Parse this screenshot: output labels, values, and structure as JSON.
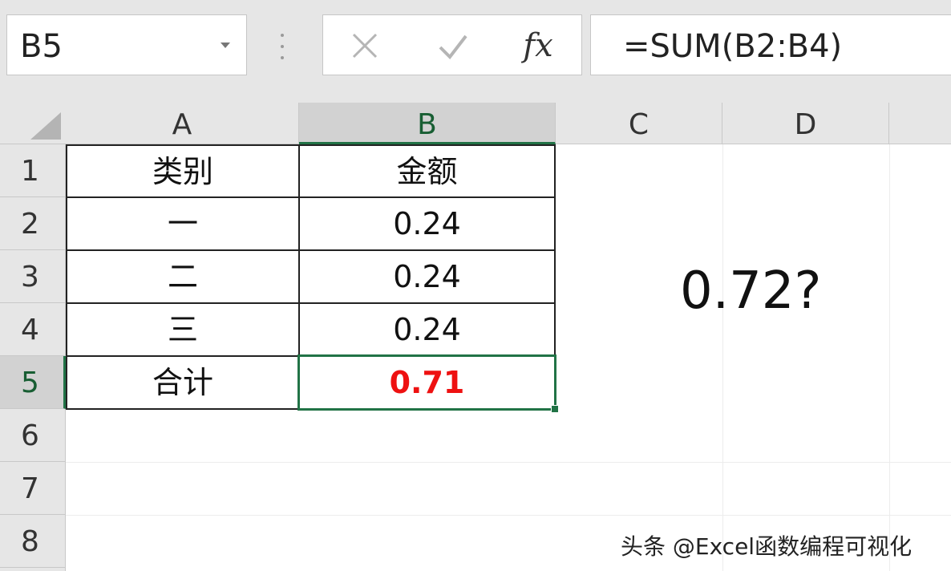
{
  "name_box": {
    "value": "B5"
  },
  "formula_bar": {
    "cancel_icon": "x-icon",
    "enter_icon": "checkmark-icon",
    "fx_label": "fx",
    "formula": "=SUM(B2:B4)"
  },
  "columns": [
    "A",
    "B",
    "C",
    "D"
  ],
  "rows": [
    "1",
    "2",
    "3",
    "4",
    "5",
    "6",
    "7",
    "8"
  ],
  "table": {
    "header": {
      "a": "类别",
      "b": "金额"
    },
    "body": [
      {
        "a": "一",
        "b": "0.24"
      },
      {
        "a": "二",
        "b": "0.24"
      },
      {
        "a": "三",
        "b": "0.24"
      }
    ],
    "total": {
      "a": "合计",
      "b": "0.71"
    }
  },
  "selected_cell": "B5",
  "colors": {
    "selection": "#217346",
    "total_value": "#ee1111"
  },
  "annotation": "0.72?",
  "watermark": "头条 @Excel函数编程可视化"
}
